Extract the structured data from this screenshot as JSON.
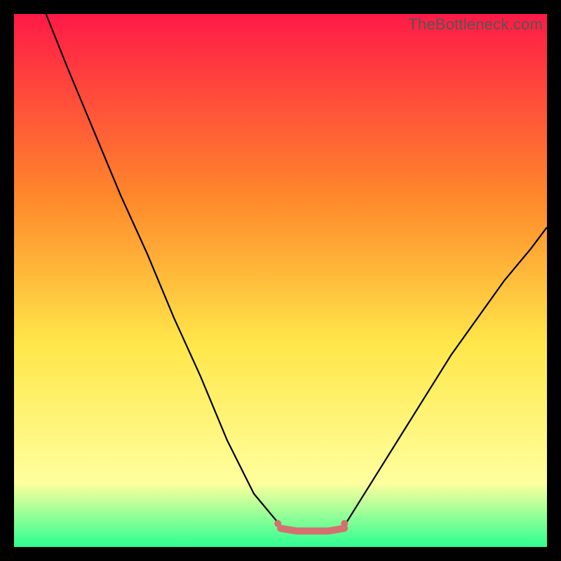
{
  "watermark": "TheBottleneck.com",
  "chart_data": {
    "type": "line",
    "title": "",
    "xlabel": "",
    "ylabel": "",
    "xlim": [
      0,
      1
    ],
    "ylim": [
      0,
      1
    ],
    "background_gradient": {
      "top": "#ff1a47",
      "mid_upper": "#ff8a2b",
      "mid": "#ffe74a",
      "mid_lower": "#ffff9e",
      "bottom": "#2cff92"
    },
    "series": [
      {
        "name": "left-curve",
        "stroke": "#000000",
        "x": [
          0.06,
          0.1,
          0.15,
          0.2,
          0.25,
          0.3,
          0.35,
          0.4,
          0.45,
          0.5
        ],
        "y": [
          1.0,
          0.9,
          0.78,
          0.66,
          0.55,
          0.43,
          0.32,
          0.2,
          0.1,
          0.04
        ]
      },
      {
        "name": "right-curve",
        "stroke": "#000000",
        "x": [
          0.62,
          0.67,
          0.72,
          0.77,
          0.82,
          0.87,
          0.92,
          0.97,
          1.0
        ],
        "y": [
          0.04,
          0.12,
          0.2,
          0.28,
          0.36,
          0.43,
          0.5,
          0.56,
          0.6
        ]
      },
      {
        "name": "bottom-flat-segment",
        "stroke": "#d47070",
        "x": [
          0.5,
          0.53,
          0.56,
          0.59,
          0.62
        ],
        "y": [
          0.035,
          0.03,
          0.03,
          0.03,
          0.035
        ]
      }
    ],
    "markers": [
      {
        "name": "left-dot",
        "x": 0.495,
        "y": 0.044,
        "r": 5,
        "fill": "#d47070"
      },
      {
        "name": "right-dot",
        "x": 0.62,
        "y": 0.044,
        "r": 5,
        "fill": "#d47070"
      }
    ]
  }
}
